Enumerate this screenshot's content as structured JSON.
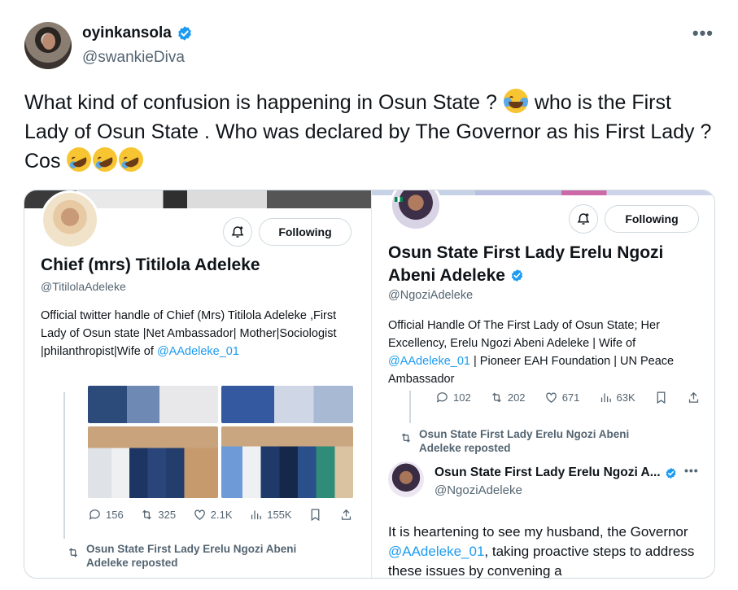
{
  "tweet": {
    "author_name": "oyinkansola",
    "author_handle": "@swankieDiva",
    "more_label": "•••",
    "text_1": "What kind of confusion is happening in Osun State ?",
    "text_2": "who is the First Lady of Osun State . Who was declared by The Governor as his First Lady ? Cos",
    "emoji_1": "face-with-tears-of-joy",
    "emoji_2": "rolling-on-the-floor-laughing"
  },
  "screenshot_left": {
    "follow_label": "Following",
    "name": "Chief (mrs) Titilola Adeleke",
    "handle": "@TitilolaAdeleke",
    "bio_1": "Official twitter handle of Chief (Mrs) Titilola Adeleke ,First Lady of Osun state |Net Ambassador| Mother|Sociologist |philanthropist|Wife of ",
    "bio_link": "@AAdeleke_01",
    "metrics": {
      "replies": "156",
      "reposts": "325",
      "likes": "2.1K",
      "views": "155K"
    },
    "reposted_label": "Osun State First Lady Erelu Ngozi Abeni Adeleke reposted"
  },
  "screenshot_right": {
    "follow_label": "Following",
    "name": "Osun State First Lady Erelu Ngozi Abeni Adeleke",
    "handle": "@NgoziAdeleke",
    "bio_1": "Official Handle Of The First Lady of Osun State; Her Excellency, Erelu Ngozi Abeni Adeleke | Wife of ",
    "bio_link": "@AAdeleke_01",
    "bio_2": " | Pioneer EAH Foundation | UN Peace Ambassador",
    "metrics": {
      "replies": "102",
      "reposts": "202",
      "likes": "671",
      "views": "63K"
    },
    "reposted_label": "Osun State First Lady Erelu Ngozi Abeni Adeleke reposted",
    "quote_name": "Osun State First Lady Erelu Ngozi A...",
    "quote_handle": "@NgoziAdeleke",
    "quote_more": "•••",
    "quote_text_1": "It is heartening to see my husband, the Governor ",
    "quote_link": "@AAdeleke_01",
    "quote_text_2": ", taking proactive steps to address these issues by convening a"
  },
  "colors": {
    "accent": "#1d9bf0",
    "text": "#0f1419",
    "muted": "#536471",
    "border": "#cfd9de"
  }
}
